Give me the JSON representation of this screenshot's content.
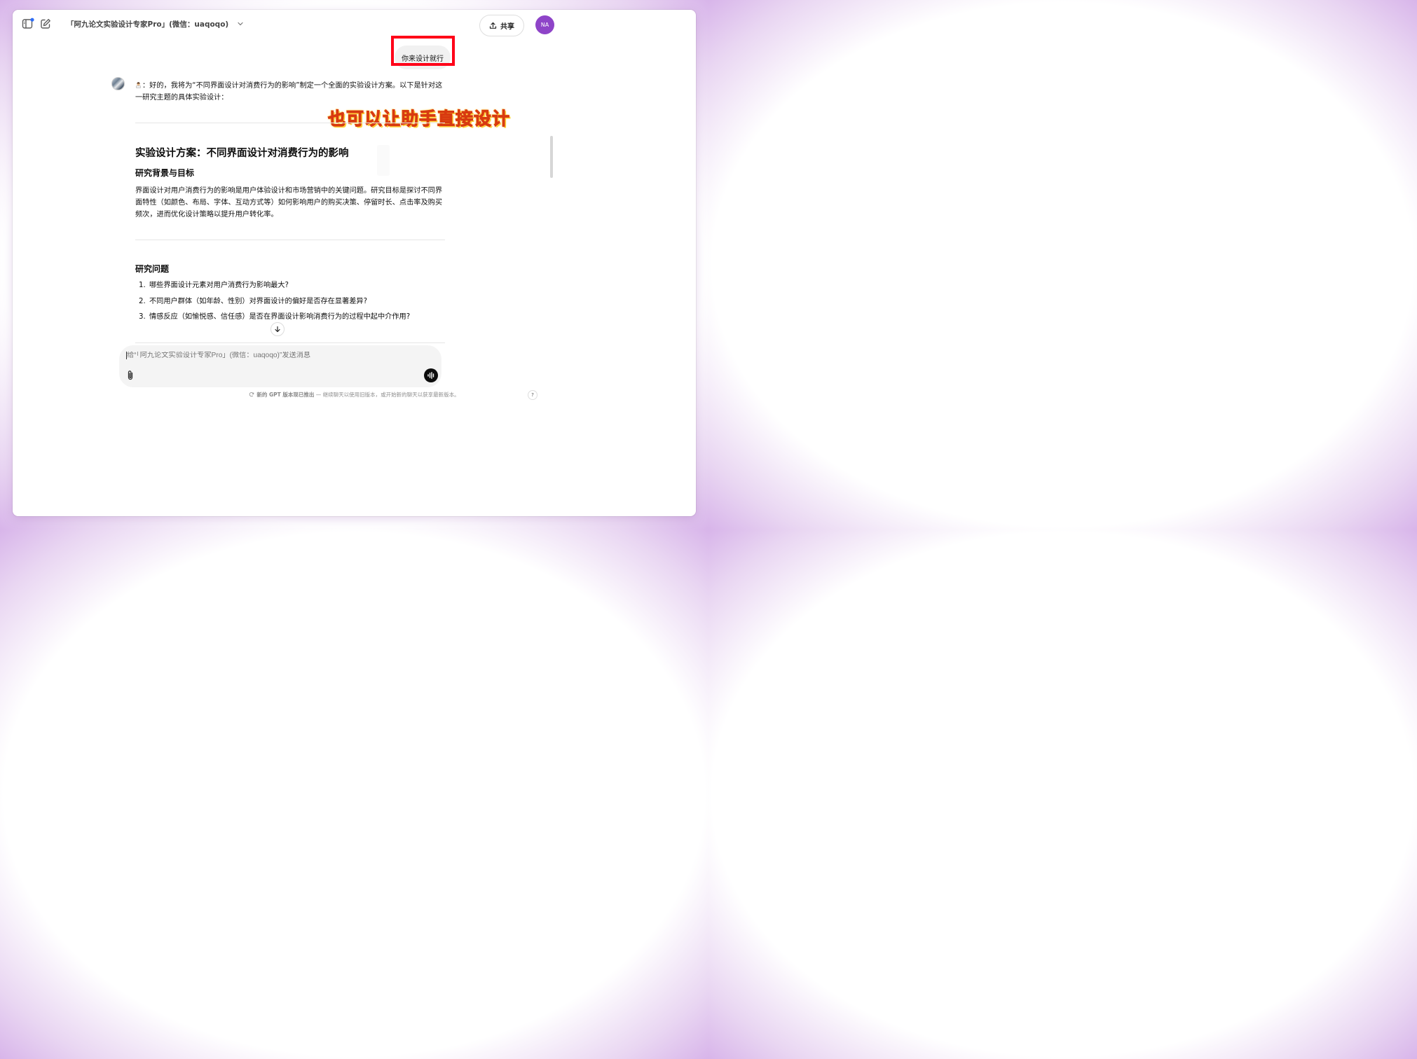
{
  "header": {
    "model_title": "「阿九论文实验设计专家Pro」(微信：uaqoqo)",
    "share_label": "共享",
    "avatar_initials": "NA"
  },
  "user_message": "你来设计就行",
  "assistant": {
    "intro": "：好的，我将为“不同界面设计对消费行为的影响”制定一个全面的实验设计方案。以下是针对这一研究主题的具体实验设计："
  },
  "overlay_annotation": "也可以让助手直接设计",
  "content": {
    "title": "实验设计方案：不同界面设计对消费行为的影响",
    "background_heading": "研究背景与目标",
    "background_paragraph": "界面设计对用户消费行为的影响是用户体验设计和市场营销中的关键问题。研究目标是探讨不同界面特性（如颜色、布局、字体、互动方式等）如何影响用户的购买决策、停留时长、点击率及购买频次，进而优化设计策略以提升用户转化率。",
    "questions_heading": "研究问题",
    "questions": [
      {
        "num": "1.",
        "text": "哪些界面设计元素对用户消费行为影响最大?"
      },
      {
        "num": "2.",
        "text": "不同用户群体（如年龄、性别）对界面设计的偏好是否存在显著差异?"
      },
      {
        "num": "3.",
        "text": "情感反应（如愉悦感、信任感）是否在界面设计影响消费行为的过程中起中介作用?"
      }
    ]
  },
  "composer": {
    "placeholder": "给“「阿九论文实验设计专家Pro」(微信：uaqoqo)”发送消息"
  },
  "footer": {
    "notice_bold": "新的 GPT 版本现已推出",
    "notice_rest": " — 继续聊天以使用旧版本，或开始新的聊天以获享最新版本。",
    "help": "?"
  },
  "colors": {
    "annotation_box": "#ff0018",
    "annotation_text": "#ff5020",
    "avatar_bg": "#8e44c8"
  },
  "icons": [
    "sidebar-icon",
    "new-chat-icon",
    "chevron-down-icon",
    "upload-icon",
    "arrow-down-icon",
    "paperclip-icon",
    "voice-icon",
    "refresh-notice-icon"
  ]
}
